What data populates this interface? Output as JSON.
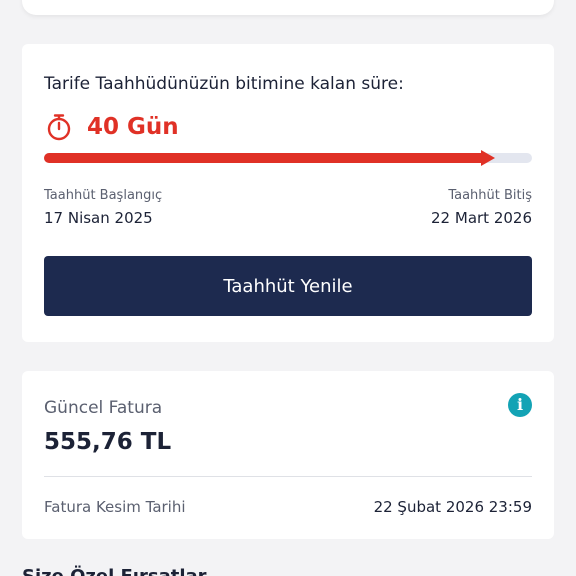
{
  "colors": {
    "accent_red": "#e03126",
    "navy": "#1d2a4f",
    "info_teal": "#13a3b5",
    "track": "#e3e6ef"
  },
  "commitment": {
    "remaining_label": "Tarife Taahhüdünüzün bitimine kalan süre:",
    "timer_icon": "stopwatch-icon",
    "days_value": "40 Gün",
    "progress_fraction": 0.9,
    "start_label": "Taahhüt Başlangıç",
    "start_date": "17 Nisan 2025",
    "end_label": "Taahhüt Bitiş",
    "end_date": "22 Mart 2026",
    "renew_button_label": "Taahhüt Yenile"
  },
  "invoice": {
    "title": "Güncel Fatura",
    "amount": "555,76 TL",
    "info_icon": "info-icon",
    "info_glyph": "i",
    "due_label": "Fatura Kesim Tarihi",
    "due_value": "22 Şubat 2026 23:59"
  },
  "next_section": {
    "title": "Size Özel Fırsatlar"
  }
}
